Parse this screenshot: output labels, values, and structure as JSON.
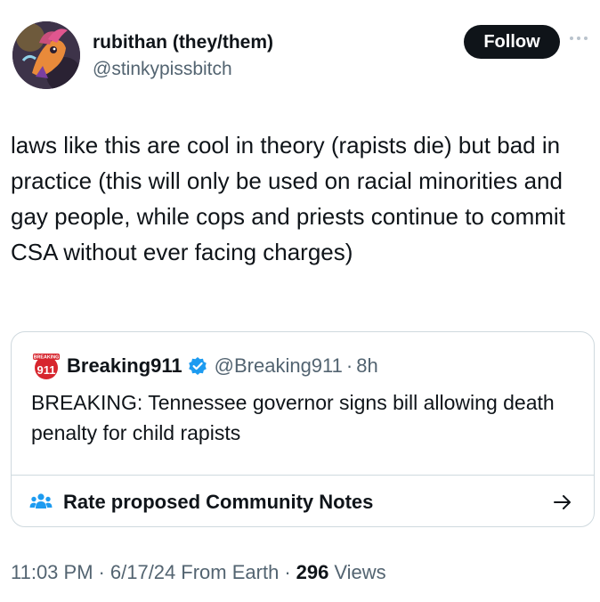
{
  "author": {
    "name": "rubithan (they/them)",
    "handle": "@stinkypissbitch",
    "avatar_icon": "avatar-image"
  },
  "follow_label": "Follow",
  "tweet_text": "laws like this are cool in theory (rapists die) but bad in practice (this will only be used on racial minorities and gay people, while cops and priests continue to commit CSA without ever facing charges)",
  "quote": {
    "name": "Breaking911",
    "handle": "@Breaking911",
    "separator": "·",
    "time": "8h",
    "logo_text": "BREAKING",
    "logo_number": "911",
    "text": "BREAKING: Tennessee governor signs bill allowing death penalty for child rapists",
    "verified_color": "#1d9bf0"
  },
  "community_notes": {
    "label": "Rate proposed Community Notes",
    "icon": "people-icon",
    "icon_color": "#1d9bf0"
  },
  "meta": {
    "time": "11:03 PM",
    "date": "6/17/24",
    "source": "From Earth",
    "views_count": "296",
    "views_label": "Views",
    "separator": "·"
  }
}
